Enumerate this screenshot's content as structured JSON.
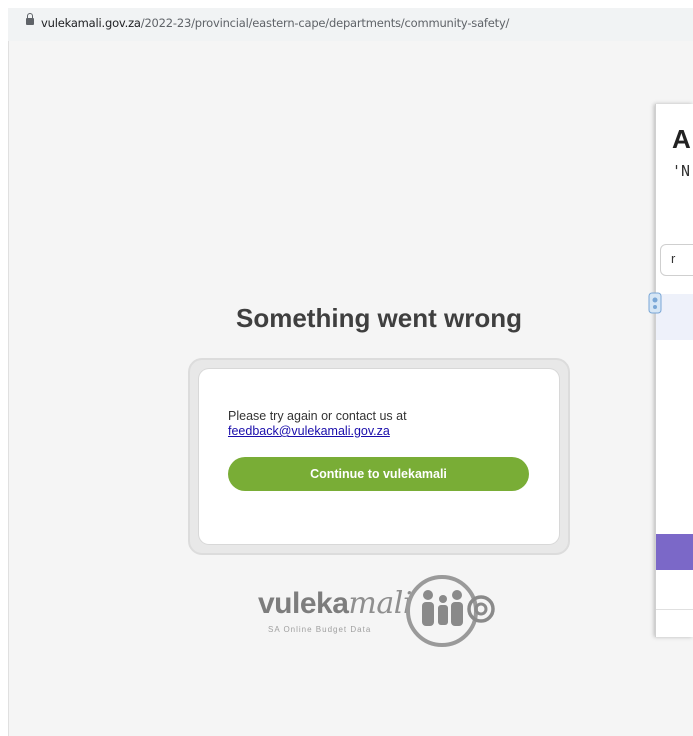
{
  "browser": {
    "url_host": "vulekamali.gov.za",
    "url_path": "/2022-23/provincial/eastern-cape/departments/community-safety/",
    "lock_icon": "lock-icon"
  },
  "error": {
    "title": "Something went wrong",
    "message": "Please try again or contact us at",
    "email_link": "feedback@vulekamali.gov.za",
    "continue_label": "Continue to vulekamali"
  },
  "logo": {
    "word_plain": "vuleka",
    "word_script": "mali",
    "tagline": "SA Online Budget Data"
  },
  "side_modal": {
    "title_fragment": "A",
    "subtitle_fragment": "'N",
    "input_fragment": "r"
  },
  "colors": {
    "accent_green": "#79ad36",
    "link_blue": "#1a0dab",
    "modal_purple": "#7b68c8"
  }
}
